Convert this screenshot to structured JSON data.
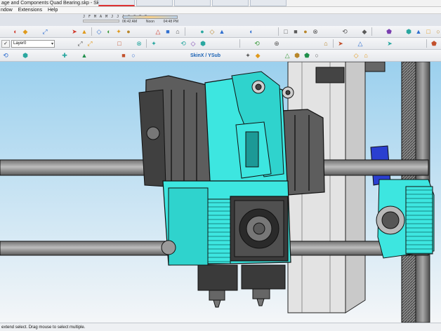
{
  "window": {
    "title": "age and Components Quad Bearing.skp - SketchUp Pro"
  },
  "browser_tabs": [
    "",
    "",
    "",
    "",
    ""
  ],
  "menu": {
    "items": [
      "ndow",
      "Extensions",
      "Help"
    ]
  },
  "shadows": {
    "months": "J F M A M J J A S O N D",
    "time_start": "06:42 AM",
    "time_mid": "Noon",
    "time_end": "04:48 PM"
  },
  "layers": {
    "current": "Layer0"
  },
  "skin_toolbar": {
    "label": "SkinX / YSub"
  },
  "status": {
    "text": "extend select. Drag mouse to select multiple."
  },
  "colors": {
    "sky_top": "#9bd0ee",
    "sky_bottom": "#f4f6f8",
    "printed_part": "#3de6e0",
    "motor": "#5d5d5d",
    "rail": "#8f8f8f",
    "accent_blue": "#2a3fd0",
    "frame": "#d9d9d9"
  },
  "icons": {
    "toolbar_1": [
      "arrow-icon",
      "eraser-icon",
      "paint-bucket-icon",
      "pencil-icon",
      "rectangle-icon",
      "circle-icon",
      "arc-icon",
      "push-pull-icon",
      "move-icon",
      "rotate-icon",
      "scale-icon",
      "offset-icon",
      "tape-measure-icon",
      "text-icon",
      "axes-icon",
      "orbit-icon",
      "pan-icon",
      "zoom-icon",
      "zoom-extents-icon",
      "iso-view-icon",
      "top-view-icon",
      "front-view-icon",
      "right-view-icon",
      "back-view-icon",
      "left-view-icon",
      "xray-icon",
      "wireframe-icon",
      "hidden-line-icon",
      "shaded-icon",
      "textured-icon",
      "monochrome-icon",
      "section-plane-icon",
      "section-display-icon",
      "component-icon",
      "warehouse-icon",
      "extension-icon",
      "shadow-icon",
      "fog-icon",
      "match-photo-icon",
      "camera-icon",
      "walk-icon",
      "look-around-icon",
      "position-camera-icon",
      "intersect-icon",
      "union-icon",
      "subtract-icon",
      "trim-icon",
      "split-icon",
      "outer-shell-icon",
      "solid-inspector-icon"
    ],
    "toolbar_2": [
      "dimension-icon",
      "protractor-icon",
      "3d-text-icon",
      "flip-icon",
      "weld-icon",
      "fillet-icon",
      "chamfer-icon",
      "curve-icon",
      "bezier-icon",
      "spline-icon",
      "polyline-icon",
      "explode-icon",
      "group-icon",
      "hide-icon",
      "unhide-icon",
      "lock-icon",
      "unlock-icon",
      "outliner-icon",
      "layers-icon",
      "styles-icon",
      "materials-icon",
      "scenes-icon",
      "instructor-icon",
      "entity-info-icon",
      "soften-icon",
      "smooth-icon",
      "sandbox-icon",
      "from-contours-icon",
      "from-scratch-icon",
      "smoove-icon",
      "stamp-icon",
      "drape-icon",
      "add-detail-icon",
      "flip-edge-icon",
      "mirror-icon",
      "array-icon",
      "grid-icon",
      "round-corner-icon",
      "extrude-icon",
      "loft-icon",
      "sweep-icon",
      "follow-me-icon",
      "offset-face-icon",
      "shell-icon",
      "cleanup-icon",
      "purge-icon"
    ],
    "toolbar_3": [
      "subdivide-icon",
      "crease-icon",
      "knife-icon",
      "select-loop-icon",
      "select-ring-icon",
      "grow-icon",
      "shrink-icon",
      "invert-icon",
      "vertex-mode-icon",
      "edge-mode-icon",
      "face-mode-icon",
      "play-icon",
      "stop-icon",
      "record-icon",
      "render-icon",
      "light-icon",
      "sun-icon",
      "material-icon",
      "texture-icon",
      "uv-icon",
      "unwrap-icon",
      "projection-icon",
      "bend-icon",
      "twist-icon",
      "taper-icon",
      "shape-bender-icon",
      "fredo-scale-icon",
      "curviloft-icon",
      "joint-push-pull-icon",
      "round-icon",
      "tools-on-surface-icon",
      "vertex-tools-icon",
      "quad-face-icon",
      "eneroth-icon",
      "export-icon"
    ]
  }
}
